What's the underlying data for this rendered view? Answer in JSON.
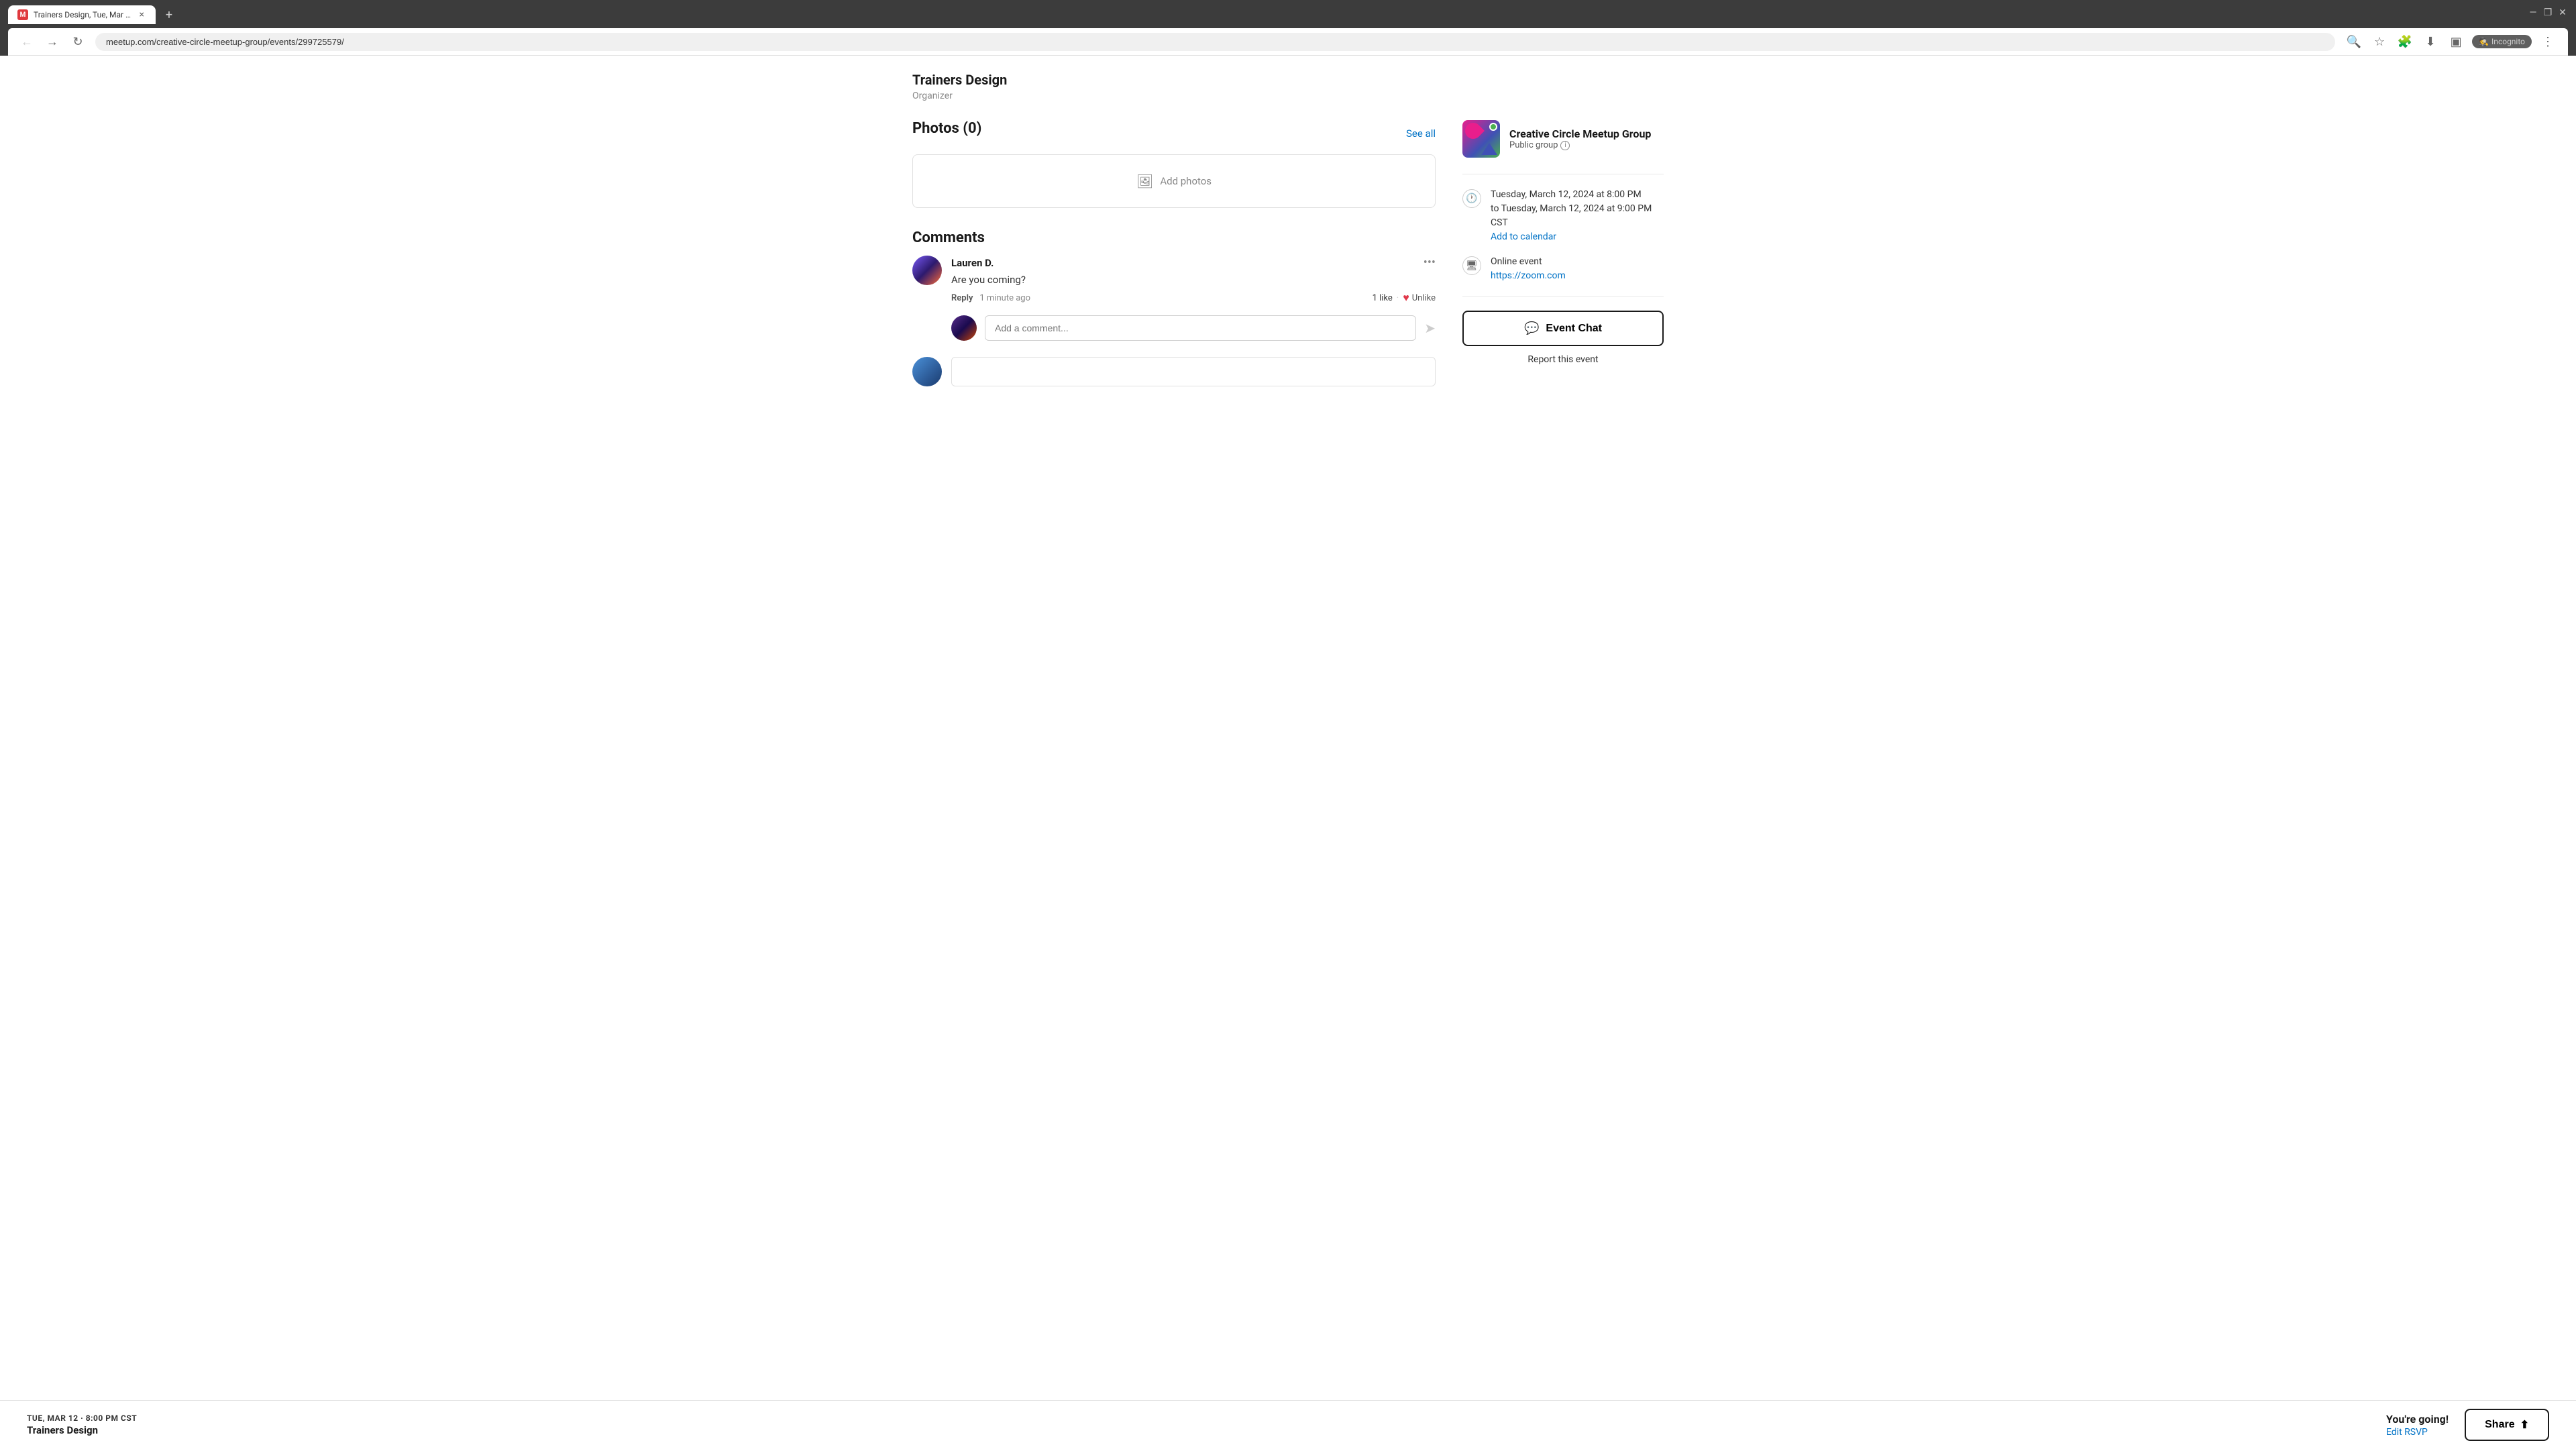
{
  "browser": {
    "tab_title": "Trainers Design, Tue, Mar 12, 2...",
    "tab_favicon": "M",
    "url": "meetup.com/creative-circle-meetup-group/events/299725579/",
    "incognito_label": "Incognito"
  },
  "page": {
    "header_title": "Trainers Design",
    "header_subtitle": "Organizer"
  },
  "photos": {
    "section_title": "Photos (0)",
    "see_all_label": "See all",
    "add_photos_label": "Add photos"
  },
  "comments": {
    "section_title": "Comments",
    "comment_1": {
      "author": "Lauren D.",
      "text": "Are you coming?",
      "time": "1 minute ago",
      "reply_label": "Reply",
      "likes": "1 like",
      "unlike_label": "Unlike"
    },
    "reply_placeholder": "Add a comment..."
  },
  "sidebar": {
    "group_name": "Creative Circle Meetup Group",
    "group_type": "Public group",
    "event_date_line1": "Tuesday, March 12, 2024 at 8:00 PM",
    "event_date_line2": "to Tuesday, March 12, 2024 at 9:00 PM CST",
    "add_to_calendar": "Add to calendar",
    "event_type": "Online event",
    "zoom_link": "https://zoom.com",
    "event_chat_label": "Event Chat",
    "report_label": "Report this event"
  },
  "bottom_bar": {
    "date": "TUE, MAR 12 · 8:00 PM CST",
    "event_title": "Trainers Design",
    "going_label": "You're going!",
    "edit_rsvp": "Edit RSVP",
    "share_label": "Share"
  }
}
